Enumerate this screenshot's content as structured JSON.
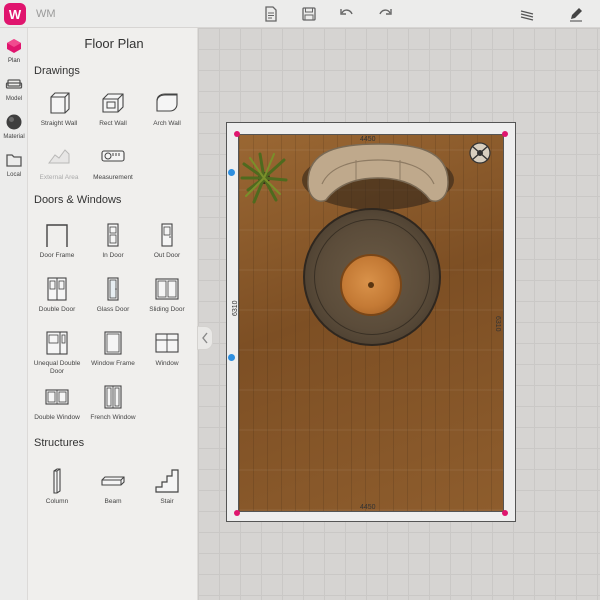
{
  "app": {
    "logo_letter": "W",
    "title": "WM"
  },
  "toolbar": {
    "buttons": [
      "document-icon",
      "save-icon",
      "undo-icon",
      "redo-icon",
      "layers-icon",
      "edit-pencil-icon"
    ]
  },
  "rail": {
    "items": [
      {
        "label": "Plan",
        "icon": "plan-cube-icon",
        "active": true
      },
      {
        "label": "Model",
        "icon": "sofa-icon"
      },
      {
        "label": "Material",
        "icon": "material-sphere-icon"
      },
      {
        "label": "Local",
        "icon": "folder-icon"
      }
    ]
  },
  "panel": {
    "title": "Floor Plan",
    "sections": {
      "drawings": {
        "title": "Drawings",
        "items": [
          "Straight Wall",
          "Rect Wall",
          "Arch Wall",
          "External Area",
          "Measurement"
        ]
      },
      "doors_windows": {
        "title": "Doors & Windows",
        "items": [
          "Door Frame",
          "In Door",
          "Out Door",
          "Double Door",
          "Glass Door",
          "Sliding Door",
          "Unequal Double Door",
          "Window Frame",
          "Window",
          "Double Window",
          "French Window"
        ]
      },
      "structures": {
        "title": "Structures",
        "items": [
          "Column",
          "Beam",
          "Stair"
        ]
      }
    }
  },
  "room": {
    "top_dimension": "4450",
    "bottom_dimension": "4450",
    "left_dimension": "6310",
    "right_dimension": "6310"
  },
  "colors": {
    "accent": "#e0156e",
    "door_marker": "#2e8fe0"
  }
}
